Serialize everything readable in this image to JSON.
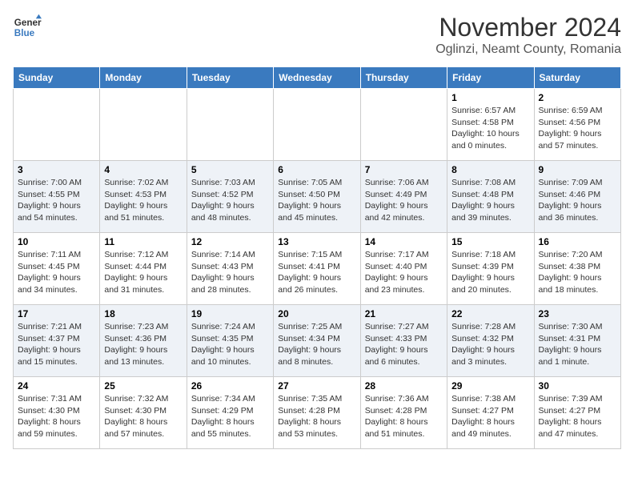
{
  "header": {
    "logo_line1": "General",
    "logo_line2": "Blue",
    "month_title": "November 2024",
    "location": "Oglinzi, Neamt County, Romania"
  },
  "columns": [
    "Sunday",
    "Monday",
    "Tuesday",
    "Wednesday",
    "Thursday",
    "Friday",
    "Saturday"
  ],
  "weeks": [
    [
      {
        "day": "",
        "info": ""
      },
      {
        "day": "",
        "info": ""
      },
      {
        "day": "",
        "info": ""
      },
      {
        "day": "",
        "info": ""
      },
      {
        "day": "",
        "info": ""
      },
      {
        "day": "1",
        "info": "Sunrise: 6:57 AM\nSunset: 4:58 PM\nDaylight: 10 hours and 0 minutes."
      },
      {
        "day": "2",
        "info": "Sunrise: 6:59 AM\nSunset: 4:56 PM\nDaylight: 9 hours and 57 minutes."
      }
    ],
    [
      {
        "day": "3",
        "info": "Sunrise: 7:00 AM\nSunset: 4:55 PM\nDaylight: 9 hours and 54 minutes."
      },
      {
        "day": "4",
        "info": "Sunrise: 7:02 AM\nSunset: 4:53 PM\nDaylight: 9 hours and 51 minutes."
      },
      {
        "day": "5",
        "info": "Sunrise: 7:03 AM\nSunset: 4:52 PM\nDaylight: 9 hours and 48 minutes."
      },
      {
        "day": "6",
        "info": "Sunrise: 7:05 AM\nSunset: 4:50 PM\nDaylight: 9 hours and 45 minutes."
      },
      {
        "day": "7",
        "info": "Sunrise: 7:06 AM\nSunset: 4:49 PM\nDaylight: 9 hours and 42 minutes."
      },
      {
        "day": "8",
        "info": "Sunrise: 7:08 AM\nSunset: 4:48 PM\nDaylight: 9 hours and 39 minutes."
      },
      {
        "day": "9",
        "info": "Sunrise: 7:09 AM\nSunset: 4:46 PM\nDaylight: 9 hours and 36 minutes."
      }
    ],
    [
      {
        "day": "10",
        "info": "Sunrise: 7:11 AM\nSunset: 4:45 PM\nDaylight: 9 hours and 34 minutes."
      },
      {
        "day": "11",
        "info": "Sunrise: 7:12 AM\nSunset: 4:44 PM\nDaylight: 9 hours and 31 minutes."
      },
      {
        "day": "12",
        "info": "Sunrise: 7:14 AM\nSunset: 4:43 PM\nDaylight: 9 hours and 28 minutes."
      },
      {
        "day": "13",
        "info": "Sunrise: 7:15 AM\nSunset: 4:41 PM\nDaylight: 9 hours and 26 minutes."
      },
      {
        "day": "14",
        "info": "Sunrise: 7:17 AM\nSunset: 4:40 PM\nDaylight: 9 hours and 23 minutes."
      },
      {
        "day": "15",
        "info": "Sunrise: 7:18 AM\nSunset: 4:39 PM\nDaylight: 9 hours and 20 minutes."
      },
      {
        "day": "16",
        "info": "Sunrise: 7:20 AM\nSunset: 4:38 PM\nDaylight: 9 hours and 18 minutes."
      }
    ],
    [
      {
        "day": "17",
        "info": "Sunrise: 7:21 AM\nSunset: 4:37 PM\nDaylight: 9 hours and 15 minutes."
      },
      {
        "day": "18",
        "info": "Sunrise: 7:23 AM\nSunset: 4:36 PM\nDaylight: 9 hours and 13 minutes."
      },
      {
        "day": "19",
        "info": "Sunrise: 7:24 AM\nSunset: 4:35 PM\nDaylight: 9 hours and 10 minutes."
      },
      {
        "day": "20",
        "info": "Sunrise: 7:25 AM\nSunset: 4:34 PM\nDaylight: 9 hours and 8 minutes."
      },
      {
        "day": "21",
        "info": "Sunrise: 7:27 AM\nSunset: 4:33 PM\nDaylight: 9 hours and 6 minutes."
      },
      {
        "day": "22",
        "info": "Sunrise: 7:28 AM\nSunset: 4:32 PM\nDaylight: 9 hours and 3 minutes."
      },
      {
        "day": "23",
        "info": "Sunrise: 7:30 AM\nSunset: 4:31 PM\nDaylight: 9 hours and 1 minute."
      }
    ],
    [
      {
        "day": "24",
        "info": "Sunrise: 7:31 AM\nSunset: 4:30 PM\nDaylight: 8 hours and 59 minutes."
      },
      {
        "day": "25",
        "info": "Sunrise: 7:32 AM\nSunset: 4:30 PM\nDaylight: 8 hours and 57 minutes."
      },
      {
        "day": "26",
        "info": "Sunrise: 7:34 AM\nSunset: 4:29 PM\nDaylight: 8 hours and 55 minutes."
      },
      {
        "day": "27",
        "info": "Sunrise: 7:35 AM\nSunset: 4:28 PM\nDaylight: 8 hours and 53 minutes."
      },
      {
        "day": "28",
        "info": "Sunrise: 7:36 AM\nSunset: 4:28 PM\nDaylight: 8 hours and 51 minutes."
      },
      {
        "day": "29",
        "info": "Sunrise: 7:38 AM\nSunset: 4:27 PM\nDaylight: 8 hours and 49 minutes."
      },
      {
        "day": "30",
        "info": "Sunrise: 7:39 AM\nSunset: 4:27 PM\nDaylight: 8 hours and 47 minutes."
      }
    ]
  ]
}
